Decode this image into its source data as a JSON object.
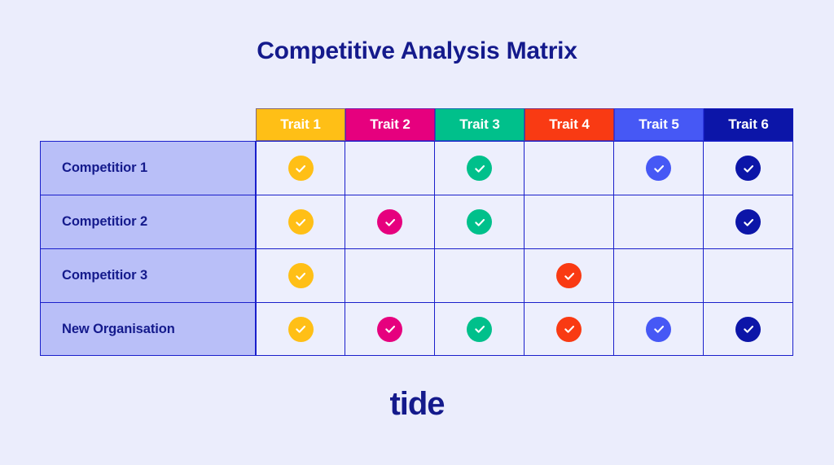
{
  "title": "Competitive Analysis Matrix",
  "brand": "tide",
  "colors": {
    "page_background": "#EBEDFC",
    "navy_text": "#141A8C",
    "border": "#1A1FCB",
    "row_label_background": "#B9BFF8",
    "cell_background": "#EDEFFD"
  },
  "chart_data": {
    "type": "table",
    "title": "Competitive Analysis Matrix",
    "xlabel": "",
    "ylabel": "",
    "columns": [
      {
        "label": "Trait 1",
        "color": "#FFBF16"
      },
      {
        "label": "Trait 2",
        "color": "#E6007E"
      },
      {
        "label": "Trait 3",
        "color": "#00C08B"
      },
      {
        "label": "Trait 4",
        "color": "#F93A13"
      },
      {
        "label": "Trait 5",
        "color": "#4658F5"
      },
      {
        "label": "Trait 6",
        "color": "#0C15A8"
      }
    ],
    "rows": [
      {
        "label": "Competitior 1",
        "values": [
          true,
          false,
          true,
          false,
          true,
          true
        ]
      },
      {
        "label": "Competitior 2",
        "values": [
          true,
          true,
          true,
          false,
          false,
          true
        ]
      },
      {
        "label": "Competitior 3",
        "values": [
          true,
          false,
          false,
          true,
          false,
          false
        ]
      },
      {
        "label": "New Organisation",
        "values": [
          true,
          true,
          true,
          true,
          true,
          true
        ]
      }
    ],
    "legend": "filled circle with white checkmark = trait present",
    "grid": true
  }
}
